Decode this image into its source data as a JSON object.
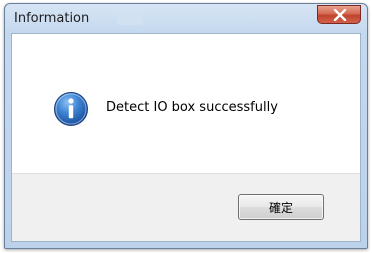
{
  "window": {
    "title": "Information"
  },
  "dialog": {
    "icon": "information-icon",
    "message": "Detect IO box successfully",
    "ok_label": "確定"
  },
  "colors": {
    "close_button": "#c0452d",
    "info_icon": "#2b6cc4"
  }
}
